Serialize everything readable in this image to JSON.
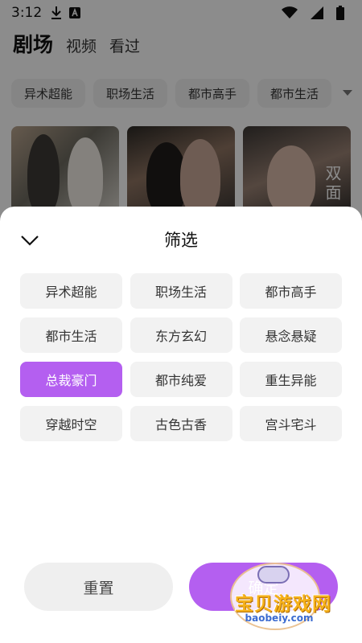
{
  "status_bar": {
    "time": "3:12"
  },
  "header": {
    "tabs": [
      {
        "label": "剧场",
        "active": true
      },
      {
        "label": "视频",
        "active": false
      },
      {
        "label": "看过",
        "active": false
      }
    ]
  },
  "category_bar": {
    "chips": [
      "异术超能",
      "职场生活",
      "都市高手",
      "都市生活"
    ]
  },
  "posters": [
    {
      "id": "p1",
      "text": ""
    },
    {
      "id": "p2",
      "text": ""
    },
    {
      "id": "p3",
      "text": "双面"
    }
  ],
  "filter_sheet": {
    "title": "筛选",
    "options": [
      {
        "label": "异术超能",
        "selected": false
      },
      {
        "label": "职场生活",
        "selected": false
      },
      {
        "label": "都市高手",
        "selected": false
      },
      {
        "label": "都市生活",
        "selected": false
      },
      {
        "label": "东方玄幻",
        "selected": false
      },
      {
        "label": "悬念悬疑",
        "selected": false
      },
      {
        "label": "总裁豪门",
        "selected": true
      },
      {
        "label": "都市纯爱",
        "selected": false
      },
      {
        "label": "重生异能",
        "selected": false
      },
      {
        "label": "穿越时空",
        "selected": false
      },
      {
        "label": "古色古香",
        "selected": false
      },
      {
        "label": "宫斗宅斗",
        "selected": false
      }
    ],
    "reset_label": "重置",
    "confirm_label": "确定"
  },
  "watermark": {
    "text": "宝贝游戏网",
    "url": "baobeiy.com"
  },
  "colors": {
    "accent": "#b45ff0",
    "chip_bg": "#f2f2f2",
    "overlay": "rgba(0,0,0,0.45)"
  },
  "icons": {
    "download": "download-icon",
    "app_badge": "app-badge-icon",
    "wifi": "wifi-icon",
    "signal": "signal-icon",
    "battery": "battery-icon",
    "more_categories": "chevron-down-icon",
    "collapse_sheet": "chevron-down-icon"
  }
}
